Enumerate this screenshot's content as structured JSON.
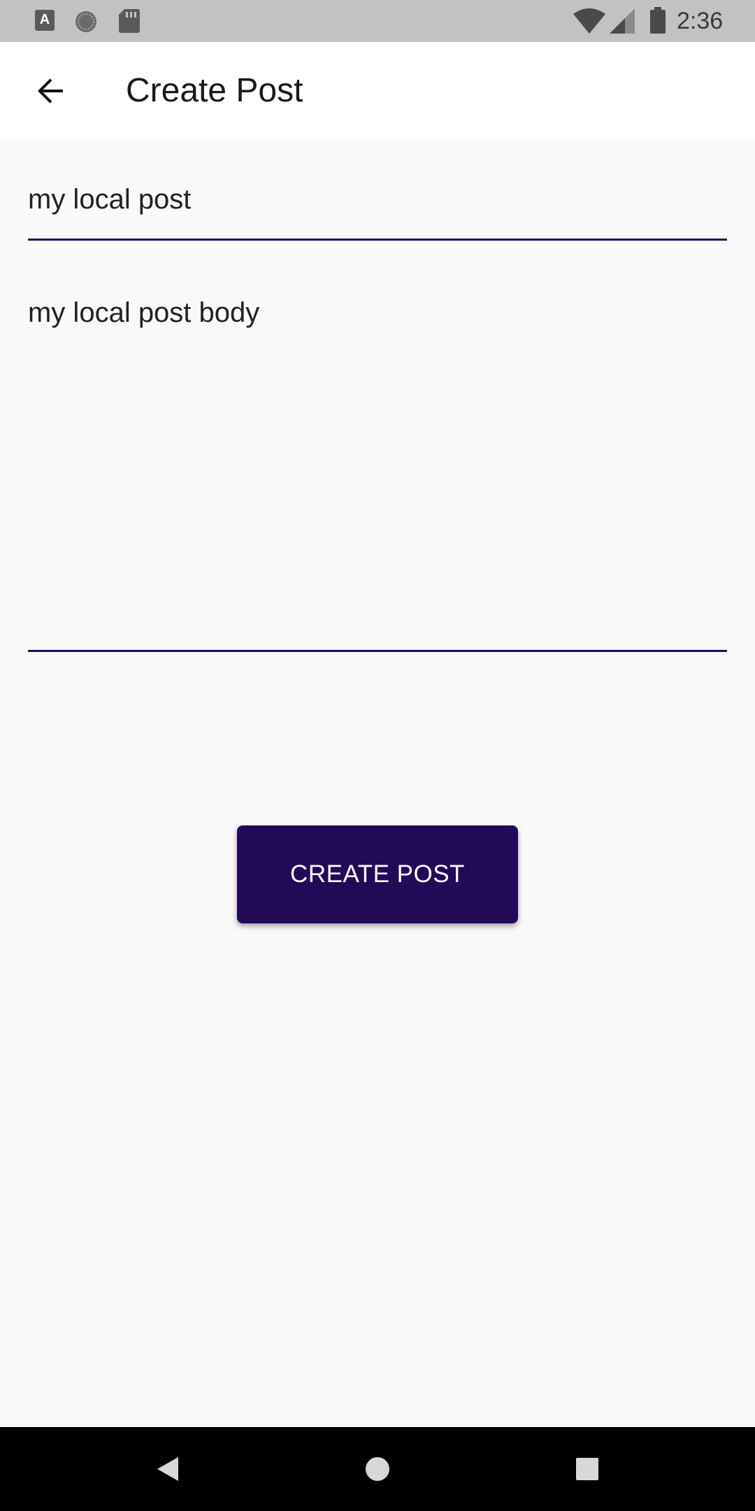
{
  "status_bar": {
    "time": "2:36",
    "notification_icons": [
      "a-notification-icon",
      "gear-notification-icon",
      "sd-card-icon"
    ],
    "system_icons": [
      "wifi-icon",
      "signal-icon",
      "battery-icon"
    ],
    "a_icon_letter": "A"
  },
  "app_bar": {
    "title": "Create Post",
    "back_icon": "arrow-back-icon"
  },
  "form": {
    "title_value": "my local post",
    "body_value": "my local post body",
    "underline_color": "#230a59"
  },
  "actions": {
    "create_label": "CREATE POST",
    "button_color": "#230a59"
  },
  "nav_bar": {
    "buttons": [
      "back-icon",
      "home-icon",
      "recents-icon"
    ]
  }
}
